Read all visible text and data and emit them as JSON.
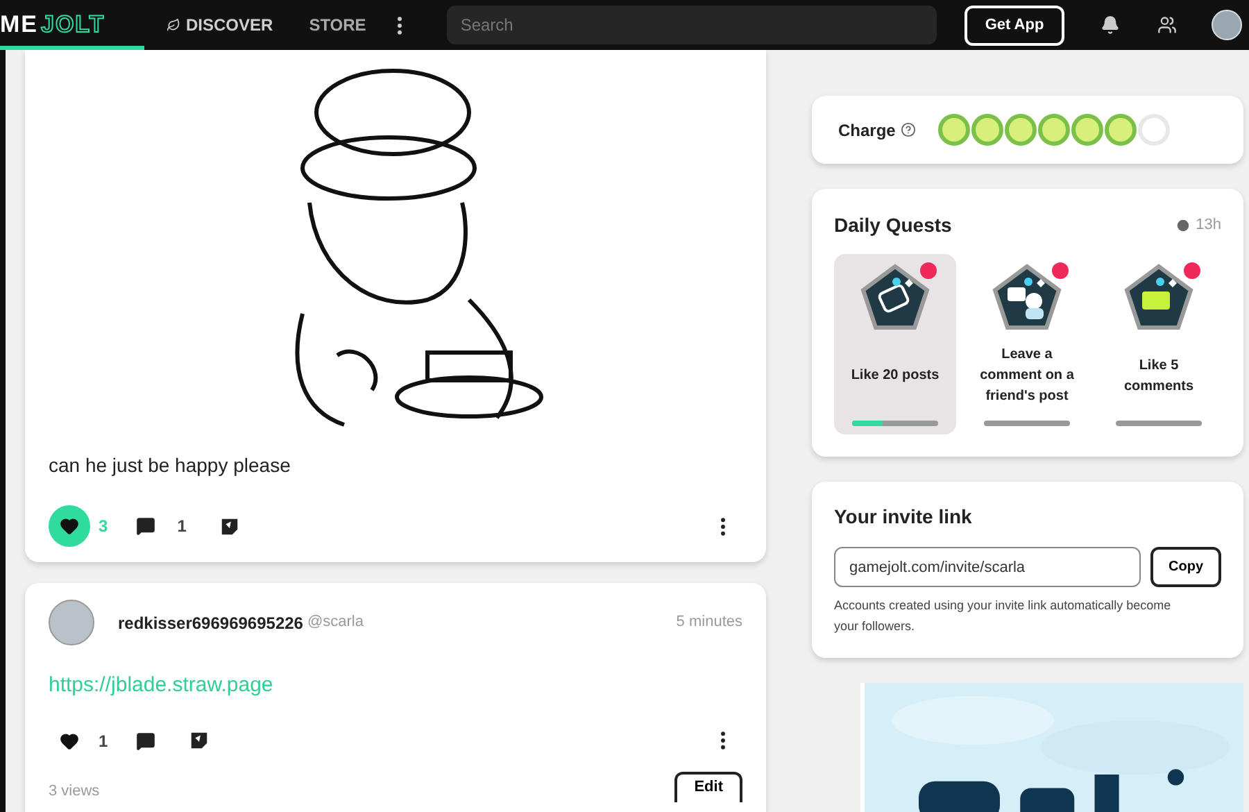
{
  "nav": {
    "logo_parts": [
      "ME",
      "JOLT"
    ],
    "links": [
      {
        "label": "DISCOVER",
        "selected": true
      },
      {
        "label": "STORE",
        "selected": false
      }
    ],
    "search": {
      "placeholder": "Search"
    },
    "get_app": "Get App"
  },
  "posts": [
    {
      "text": "can he just be happy please",
      "likes": "3",
      "liked": true,
      "comments": "1"
    },
    {
      "kind": "link",
      "author": "redkisser696969695226",
      "handle": "@scarla",
      "time": "5 minutes",
      "link": "https://jblade.straw.page",
      "likes": "1",
      "liked": false,
      "views": "3 views",
      "edit": "Edit"
    }
  ],
  "charge": {
    "label": "Charge",
    "orbs": [
      {
        "filled": true
      },
      {
        "filled": true
      },
      {
        "filled": true
      },
      {
        "filled": true
      },
      {
        "filled": true
      },
      {
        "filled": true
      },
      {
        "filled": false
      }
    ]
  },
  "quests": {
    "title": "Daily Quests",
    "time": "13h",
    "items": [
      {
        "label": "Like 20 posts",
        "selected": true,
        "new": true,
        "level": 0.35
      },
      {
        "label": "Leave a comment on a friend's post",
        "selected": false,
        "new": true,
        "level": 0
      },
      {
        "label": "Like 5 comments",
        "selected": false,
        "new": true,
        "level": 0
      }
    ]
  },
  "invite": {
    "title": "Your invite link",
    "value": "gamejolt.com/invite/scarla",
    "copy": "Copy",
    "note": "Accounts created using your invite link automatically become your followers."
  }
}
